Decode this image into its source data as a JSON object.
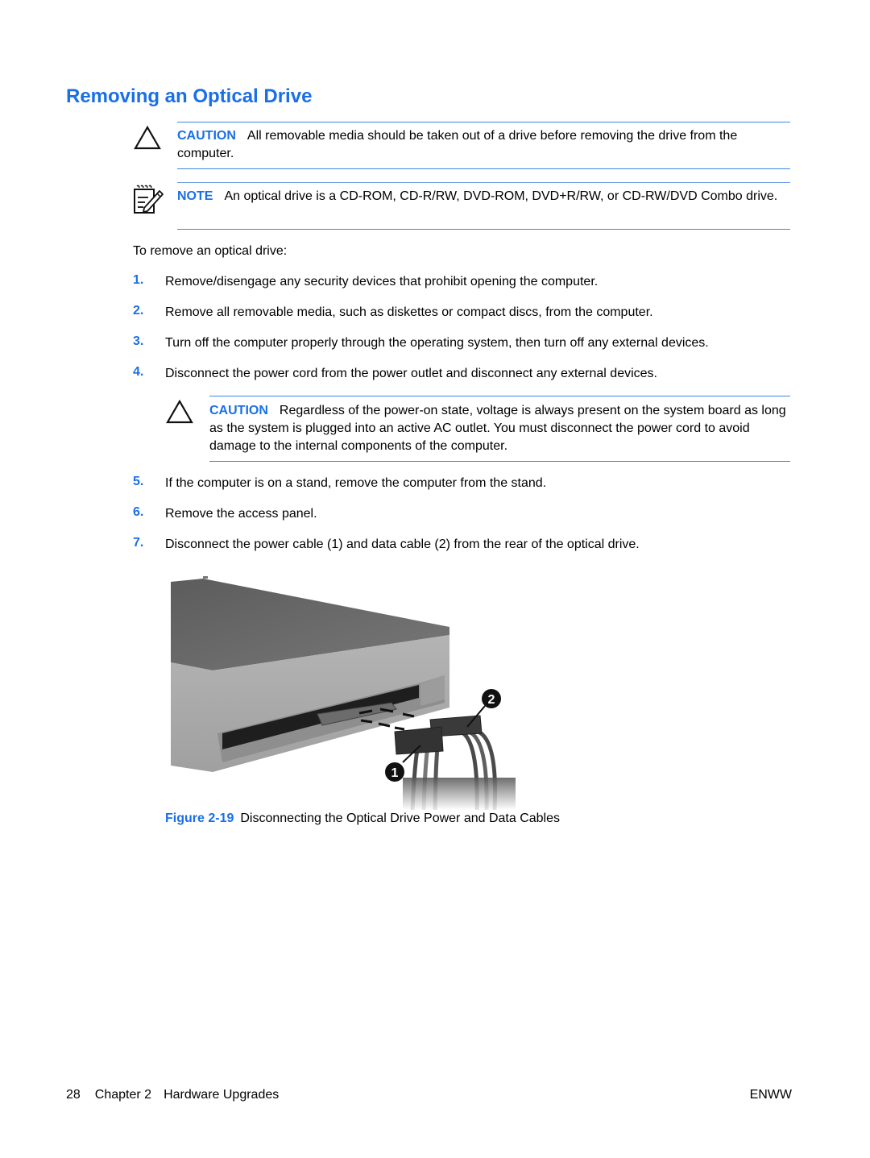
{
  "page": {
    "title": "Removing an Optical Drive",
    "caution1": {
      "label": "CAUTION",
      "text": "All removable media should be taken out of a drive before removing the drive from the computer."
    },
    "note": {
      "label": "NOTE",
      "text": "An optical drive is a CD-ROM, CD-R/RW, DVD-ROM, DVD+R/RW, or CD-RW/DVD Combo drive."
    },
    "intro": "To remove an optical drive:",
    "steps": [
      {
        "num": "1.",
        "text": "Remove/disengage any security devices that prohibit opening the computer."
      },
      {
        "num": "2.",
        "text": "Remove all removable media, such as diskettes or compact discs, from the computer."
      },
      {
        "num": "3.",
        "text": "Turn off the computer properly through the operating system, then turn off any external devices."
      },
      {
        "num": "4.",
        "text": "Disconnect the power cord from the power outlet and disconnect any external devices."
      },
      {
        "num": "5.",
        "text": "If the computer is on a stand, remove the computer from the stand."
      },
      {
        "num": "6.",
        "text": "Remove the access panel."
      },
      {
        "num": "7.",
        "text": "Disconnect the power cable (1) and data cable (2) from the rear of the optical drive."
      }
    ],
    "caution2": {
      "label": "CAUTION",
      "text": "Regardless of the power-on state, voltage is always present on the system board as long as the system is plugged into an active AC outlet. You must disconnect the power cord to avoid damage to the internal components of the computer."
    },
    "figure": {
      "callouts": [
        "1",
        "2"
      ],
      "label": "Figure 2-19",
      "caption": "Disconnecting the Optical Drive Power and Data Cables"
    },
    "footer": {
      "page_number": "28",
      "chapter": "Chapter 2",
      "chapter_title": "Hardware Upgrades",
      "right": "ENWW"
    }
  }
}
